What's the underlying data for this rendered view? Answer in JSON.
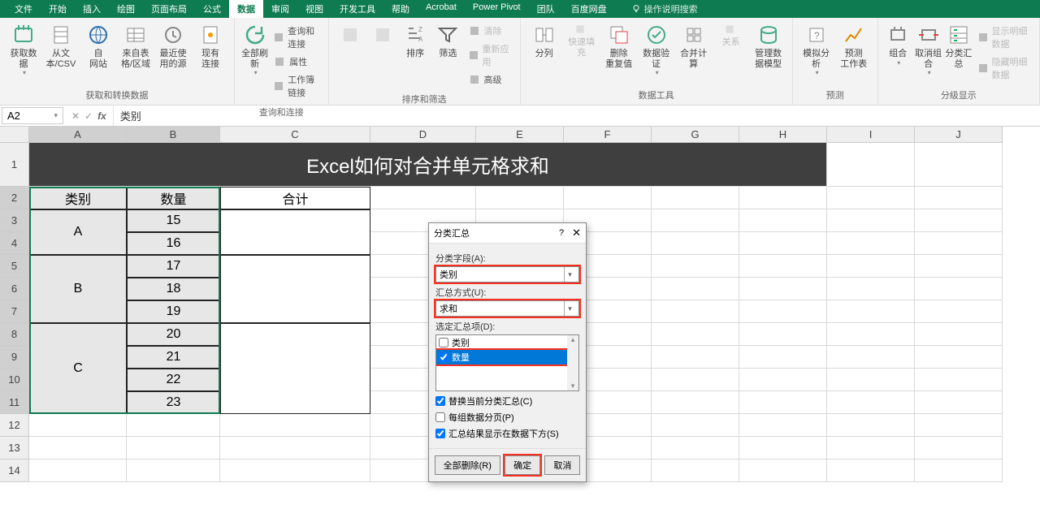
{
  "menu": {
    "items": [
      "文件",
      "开始",
      "插入",
      "绘图",
      "页面布局",
      "公式",
      "数据",
      "审阅",
      "视图",
      "开发工具",
      "帮助",
      "Acrobat",
      "Power Pivot",
      "团队",
      "百度网盘"
    ],
    "active_index": 6,
    "search": "操作说明搜索"
  },
  "ribbon": {
    "groups": [
      {
        "label": "获取和转换数据",
        "items": [
          {
            "t": "获取数\n据",
            "k": "get-data"
          },
          {
            "t": "从文\n本/CSV",
            "k": "from-csv"
          },
          {
            "t": "自\n网站",
            "k": "from-web"
          },
          {
            "t": "来自表\n格/区域",
            "k": "from-table"
          },
          {
            "t": "最近使\n用的源",
            "k": "recent"
          },
          {
            "t": "现有\n连接",
            "k": "existing-conn"
          }
        ]
      },
      {
        "label": "查询和连接",
        "items": [
          {
            "t": "全部刷新",
            "k": "refresh-all"
          }
        ],
        "side": [
          {
            "t": "查询和连接",
            "k": "queries"
          },
          {
            "t": "属性",
            "k": "properties"
          },
          {
            "t": "工作簿链接",
            "k": "workbook-links"
          }
        ]
      },
      {
        "label": "排序和筛选",
        "items": [
          {
            "t": "",
            "k": "sort-az"
          },
          {
            "t": "",
            "k": "sort-za"
          },
          {
            "t": "排序",
            "k": "sort"
          },
          {
            "t": "筛选",
            "k": "filter"
          }
        ],
        "side": [
          {
            "t": "清除",
            "k": "clear",
            "dim": true
          },
          {
            "t": "重新应用",
            "k": "reapply",
            "dim": true
          },
          {
            "t": "高级",
            "k": "advanced"
          }
        ]
      },
      {
        "label": "数据工具",
        "items": [
          {
            "t": "分列",
            "k": "text-to-cols"
          },
          {
            "t": "快速填充",
            "k": "flash-fill",
            "dim": true
          },
          {
            "t": "删除\n重复值",
            "k": "remove-dup"
          },
          {
            "t": "数据验\n证",
            "k": "validation"
          },
          {
            "t": "合并计算",
            "k": "consolidate"
          },
          {
            "t": "关系",
            "k": "relationships",
            "dim": true
          },
          {
            "t": "管理数\n据模型",
            "k": "data-model"
          }
        ]
      },
      {
        "label": "预测",
        "items": [
          {
            "t": "模拟分析",
            "k": "what-if"
          },
          {
            "t": "预测\n工作表",
            "k": "forecast"
          }
        ]
      },
      {
        "label": "分级显示",
        "items": [
          {
            "t": "组合",
            "k": "group"
          },
          {
            "t": "取消组合",
            "k": "ungroup"
          },
          {
            "t": "分类汇总",
            "k": "subtotal"
          }
        ],
        "side": [
          {
            "t": "显示明细数据",
            "k": "show-detail",
            "dim": true
          },
          {
            "t": "隐藏明细数据",
            "k": "hide-detail",
            "dim": true
          }
        ]
      }
    ]
  },
  "namebox": "A2",
  "formula": "类别",
  "columns": [
    "A",
    "B",
    "C",
    "D",
    "E",
    "F",
    "G",
    "H",
    "I",
    "J"
  ],
  "rows": [
    "1",
    "2",
    "3",
    "4",
    "5",
    "6",
    "7",
    "8",
    "9",
    "10",
    "11",
    "12",
    "13",
    "14"
  ],
  "title_text": "Excel如何对合并单元格求和",
  "table": {
    "headers": [
      "类别",
      "数量",
      "合计"
    ],
    "data": [
      {
        "cat": "A",
        "span": 2,
        "vals": [
          15,
          16
        ]
      },
      {
        "cat": "B",
        "span": 3,
        "vals": [
          17,
          18,
          19
        ]
      },
      {
        "cat": "C",
        "span": 4,
        "vals": [
          20,
          21,
          22,
          23
        ]
      }
    ]
  },
  "dialog": {
    "title": "分类汇总",
    "help": "?",
    "field_label": "分类字段(A):",
    "field_value": "类别",
    "method_label": "汇总方式(U):",
    "method_value": "求和",
    "items_label": "选定汇总项(D):",
    "list": [
      {
        "t": "类别",
        "chk": false
      },
      {
        "t": "数量",
        "chk": true,
        "sel": true
      }
    ],
    "opt1": "替换当前分类汇总(C)",
    "opt2": "每组数据分页(P)",
    "opt3": "汇总结果显示在数据下方(S)",
    "btn_remove": "全部删除(R)",
    "btn_ok": "确定",
    "btn_cancel": "取消"
  }
}
